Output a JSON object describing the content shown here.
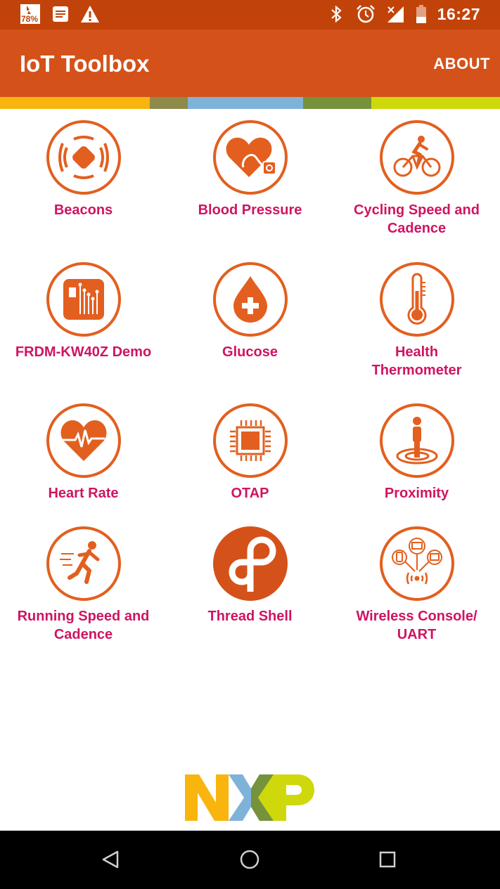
{
  "status_bar": {
    "battery_badge": "78%",
    "time": "16:27",
    "left_icons": [
      "battery-saver-icon",
      "notes-icon",
      "warning-icon"
    ],
    "right_icons": [
      "bluetooth-icon",
      "alarm-icon",
      "signal-icon",
      "battery-icon"
    ]
  },
  "app_bar": {
    "title": "IoT Toolbox",
    "about_label": "ABOUT"
  },
  "colors": {
    "status_bar": "#c24309",
    "app_bar": "#d4521a",
    "accent": "#e35f1f",
    "label": "#cf1462",
    "stripe": [
      "#f9b40e",
      "#8e8a4a",
      "#7fb2d9",
      "#76923b",
      "#cfd80b"
    ]
  },
  "grid": {
    "items": [
      {
        "label_line1": "Beacons",
        "label_line2": "",
        "icon": "beacon-icon"
      },
      {
        "label_line1": "Blood Pressure",
        "label_line2": "",
        "icon": "blood-pressure-icon"
      },
      {
        "label_line1": "Cycling Speed and",
        "label_line2": "Cadence",
        "icon": "cyclist-icon"
      },
      {
        "label_line1": "FRDM-KW40Z Demo",
        "label_line2": "",
        "icon": "board-chip-icon"
      },
      {
        "label_line1": "Glucose",
        "label_line2": "",
        "icon": "blood-drop-icon"
      },
      {
        "label_line1": "Health",
        "label_line2": "Thermometer",
        "icon": "thermometer-icon"
      },
      {
        "label_line1": "Heart Rate",
        "label_line2": "",
        "icon": "heart-pulse-icon"
      },
      {
        "label_line1": "OTAP",
        "label_line2": "",
        "icon": "processor-icon"
      },
      {
        "label_line1": "Proximity",
        "label_line2": "",
        "icon": "person-proximity-icon"
      },
      {
        "label_line1": "Running Speed and",
        "label_line2": "Cadence",
        "icon": "runner-icon"
      },
      {
        "label_line1": "Thread Shell",
        "label_line2": "",
        "icon": "thread-logo-icon"
      },
      {
        "label_line1": "Wireless Console/",
        "label_line2": "UART",
        "icon": "wireless-devices-icon"
      }
    ]
  },
  "footer": {
    "logo_text": "NXP",
    "logo_colors": [
      "#f9b40e",
      "#7fb2d9",
      "#76923b",
      "#cfd80b"
    ]
  },
  "nav_bar": {
    "buttons": [
      "back-icon",
      "home-icon",
      "recents-icon"
    ]
  }
}
